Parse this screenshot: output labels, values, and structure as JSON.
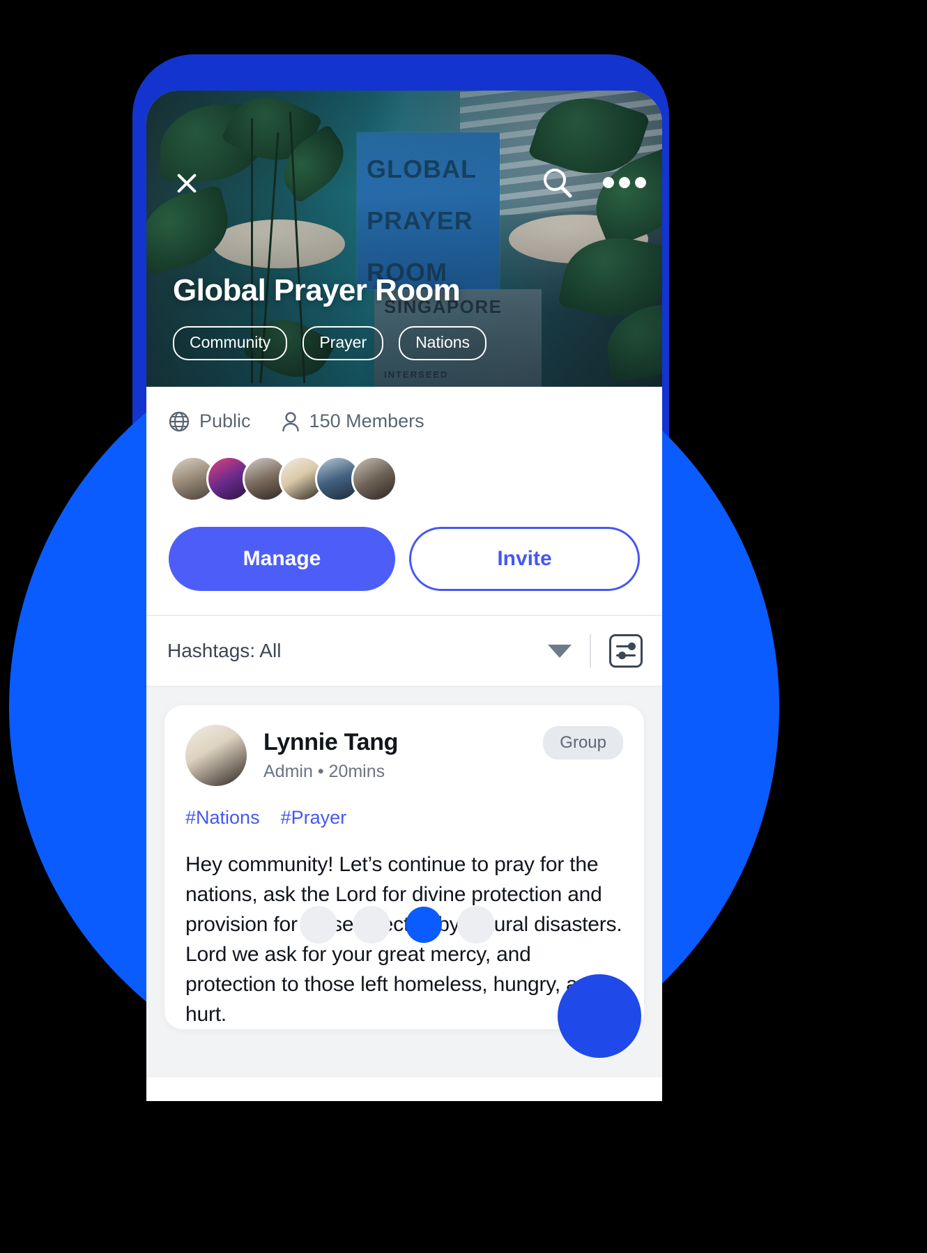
{
  "cover": {
    "poster_lines": [
      "GLOBAL",
      "PRAYER",
      "ROOM"
    ],
    "poster2_title": "SINGAPORE",
    "poster2_sub": "INTERSEED",
    "close_icon": "close-icon",
    "search_icon": "search-icon",
    "more_icon": "more-options-icon"
  },
  "group": {
    "title": "Global Prayer Room",
    "tags": [
      "Community",
      "Prayer",
      "Nations"
    ],
    "visibility": "Public",
    "members": "150 Members",
    "globe_icon": "globe-icon",
    "person_icon": "person-icon"
  },
  "actions": {
    "manage": "Manage",
    "invite": "Invite"
  },
  "filter": {
    "label": "Hashtags: All",
    "caret_icon": "chevron-down-icon",
    "settings_icon": "filter-settings-icon"
  },
  "post": {
    "author": "Lynnie Tang",
    "role": "Admin",
    "separator": "•",
    "time": "20mins",
    "badge": "Group",
    "hashtags": [
      "#Nations",
      "#Prayer"
    ],
    "body": "Hey community! Let’s continue to pray for the nations, ask the Lord for divine protection and provision for those affected by natural disasters. Lord we ask for your great mercy, and protection to those left homeless, hungry, and hurt."
  },
  "colors": {
    "primary": "#4c5ef7",
    "accent_blue": "#0b5cff",
    "link": "#4558f0",
    "muted": "#6b7480"
  }
}
